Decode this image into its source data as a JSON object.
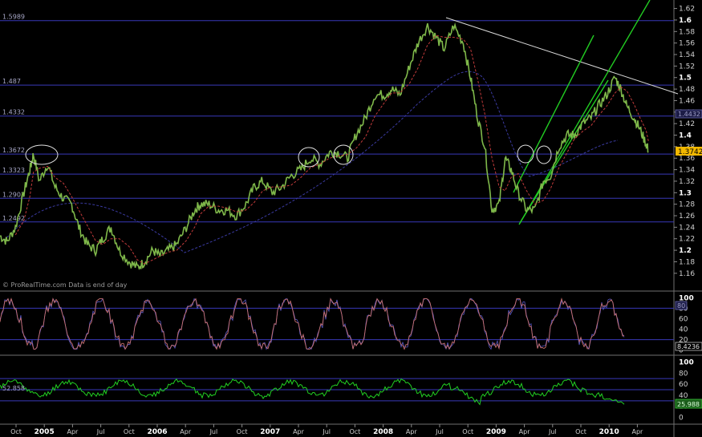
{
  "chart_data": {
    "type": "line",
    "watermark": "© ProRealTime.com  Data is end of day",
    "last_price_label": "1.3742",
    "x_ticks": [
      {
        "label": "Oct",
        "bold": false
      },
      {
        "label": "2005",
        "bold": true
      },
      {
        "label": "Apr",
        "bold": false
      },
      {
        "label": "Jul",
        "bold": false
      },
      {
        "label": "Oct",
        "bold": false
      },
      {
        "label": "2006",
        "bold": true
      },
      {
        "label": "Apr",
        "bold": false
      },
      {
        "label": "Jul",
        "bold": false
      },
      {
        "label": "Oct",
        "bold": false
      },
      {
        "label": "2007",
        "bold": true
      },
      {
        "label": "Apr",
        "bold": false
      },
      {
        "label": "Jul",
        "bold": false
      },
      {
        "label": "Oct",
        "bold": false
      },
      {
        "label": "2008",
        "bold": true
      },
      {
        "label": "Apr",
        "bold": false
      },
      {
        "label": "Jul",
        "bold": false
      },
      {
        "label": "Oct",
        "bold": false
      },
      {
        "label": "2009",
        "bold": true
      },
      {
        "label": "Apr",
        "bold": false
      },
      {
        "label": "Jul",
        "bold": false
      },
      {
        "label": "Oct",
        "bold": false
      },
      {
        "label": "2010",
        "bold": true
      },
      {
        "label": "Apr",
        "bold": false
      }
    ],
    "price_panel": {
      "y_ticks": [
        "1.62",
        "1.6",
        "1.58",
        "1.56",
        "1.54",
        "1.52",
        "1.5",
        "1.48",
        "1.46",
        "1.44",
        "1.42",
        "1.4",
        "1.38",
        "1.36",
        "1.34",
        "1.32",
        "1.3",
        "1.28",
        "1.26",
        "1.24",
        "1.22",
        "1.2",
        "1.18",
        "1.16"
      ],
      "bold_ticks": [
        "1.6",
        "1.5",
        "1.4",
        "1.3",
        "1.2"
      ],
      "ylim": [
        1.15,
        1.625
      ],
      "levels": [
        "1.5989",
        "1.487",
        "1.4332",
        "1.3672",
        "1.3323",
        "1.2903",
        "1.2492"
      ],
      "right_box_label": "1.4432",
      "price_series": [
        [
          2004.72,
          1.225
        ],
        [
          2004.78,
          1.215
        ],
        [
          2004.85,
          1.24
        ],
        [
          2004.92,
          1.3
        ],
        [
          2004.97,
          1.34
        ],
        [
          2005.0,
          1.367
        ],
        [
          2005.05,
          1.32
        ],
        [
          2005.12,
          1.35
        ],
        [
          2005.18,
          1.31
        ],
        [
          2005.25,
          1.29
        ],
        [
          2005.32,
          1.28
        ],
        [
          2005.38,
          1.24
        ],
        [
          2005.45,
          1.21
        ],
        [
          2005.52,
          1.2
        ],
        [
          2005.58,
          1.22
        ],
        [
          2005.65,
          1.24
        ],
        [
          2005.72,
          1.2
        ],
        [
          2005.8,
          1.18
        ],
        [
          2005.87,
          1.17
        ],
        [
          2005.93,
          1.18
        ],
        [
          2006.0,
          1.2
        ],
        [
          2006.06,
          1.19
        ],
        [
          2006.13,
          1.2
        ],
        [
          2006.2,
          1.21
        ],
        [
          2006.28,
          1.24
        ],
        [
          2006.35,
          1.27
        ],
        [
          2006.4,
          1.28
        ],
        [
          2006.47,
          1.28
        ],
        [
          2006.55,
          1.27
        ],
        [
          2006.62,
          1.27
        ],
        [
          2006.7,
          1.26
        ],
        [
          2006.78,
          1.28
        ],
        [
          2006.85,
          1.31
        ],
        [
          2006.92,
          1.32
        ],
        [
          2007.0,
          1.3
        ],
        [
          2007.08,
          1.31
        ],
        [
          2007.16,
          1.33
        ],
        [
          2007.24,
          1.34
        ],
        [
          2007.32,
          1.36
        ],
        [
          2007.4,
          1.35
        ],
        [
          2007.48,
          1.37
        ],
        [
          2007.55,
          1.37
        ],
        [
          2007.63,
          1.36
        ],
        [
          2007.7,
          1.4
        ],
        [
          2007.78,
          1.43
        ],
        [
          2007.86,
          1.47
        ],
        [
          2007.94,
          1.47
        ],
        [
          2008.0,
          1.48
        ],
        [
          2008.07,
          1.47
        ],
        [
          2008.15,
          1.52
        ],
        [
          2008.22,
          1.56
        ],
        [
          2008.3,
          1.59
        ],
        [
          2008.37,
          1.57
        ],
        [
          2008.44,
          1.55
        ],
        [
          2008.52,
          1.59
        ],
        [
          2008.6,
          1.56
        ],
        [
          2008.66,
          1.5
        ],
        [
          2008.72,
          1.43
        ],
        [
          2008.78,
          1.38
        ],
        [
          2008.84,
          1.27
        ],
        [
          2008.9,
          1.28
        ],
        [
          2008.95,
          1.36
        ],
        [
          2009.0,
          1.34
        ],
        [
          2009.06,
          1.3
        ],
        [
          2009.13,
          1.27
        ],
        [
          2009.2,
          1.27
        ],
        [
          2009.27,
          1.32
        ],
        [
          2009.33,
          1.33
        ],
        [
          2009.4,
          1.38
        ],
        [
          2009.47,
          1.4
        ],
        [
          2009.53,
          1.4
        ],
        [
          2009.6,
          1.42
        ],
        [
          2009.67,
          1.43
        ],
        [
          2009.73,
          1.45
        ],
        [
          2009.8,
          1.47
        ],
        [
          2009.87,
          1.5
        ],
        [
          2009.92,
          1.48
        ],
        [
          2009.97,
          1.45
        ],
        [
          2010.03,
          1.43
        ],
        [
          2010.08,
          1.41
        ],
        [
          2010.13,
          1.385
        ],
        [
          2010.15,
          1.374
        ]
      ]
    },
    "stoch_panel": {
      "y_ticks": [
        "100",
        "80",
        "60",
        "40",
        "20",
        "0"
      ],
      "ylim": [
        -5,
        105
      ],
      "levels": [
        "80",
        "20"
      ],
      "right_top_box": "80",
      "right_bottom_box": "8.4236"
    },
    "rsi_panel": {
      "y_ticks": [
        "100",
        "80",
        "60",
        "40",
        "20",
        "0"
      ],
      "ylim": [
        -5,
        105
      ],
      "levels": [
        "70",
        "50",
        "30"
      ],
      "level_label": "52.858",
      "right_box_label": "25.988"
    }
  }
}
